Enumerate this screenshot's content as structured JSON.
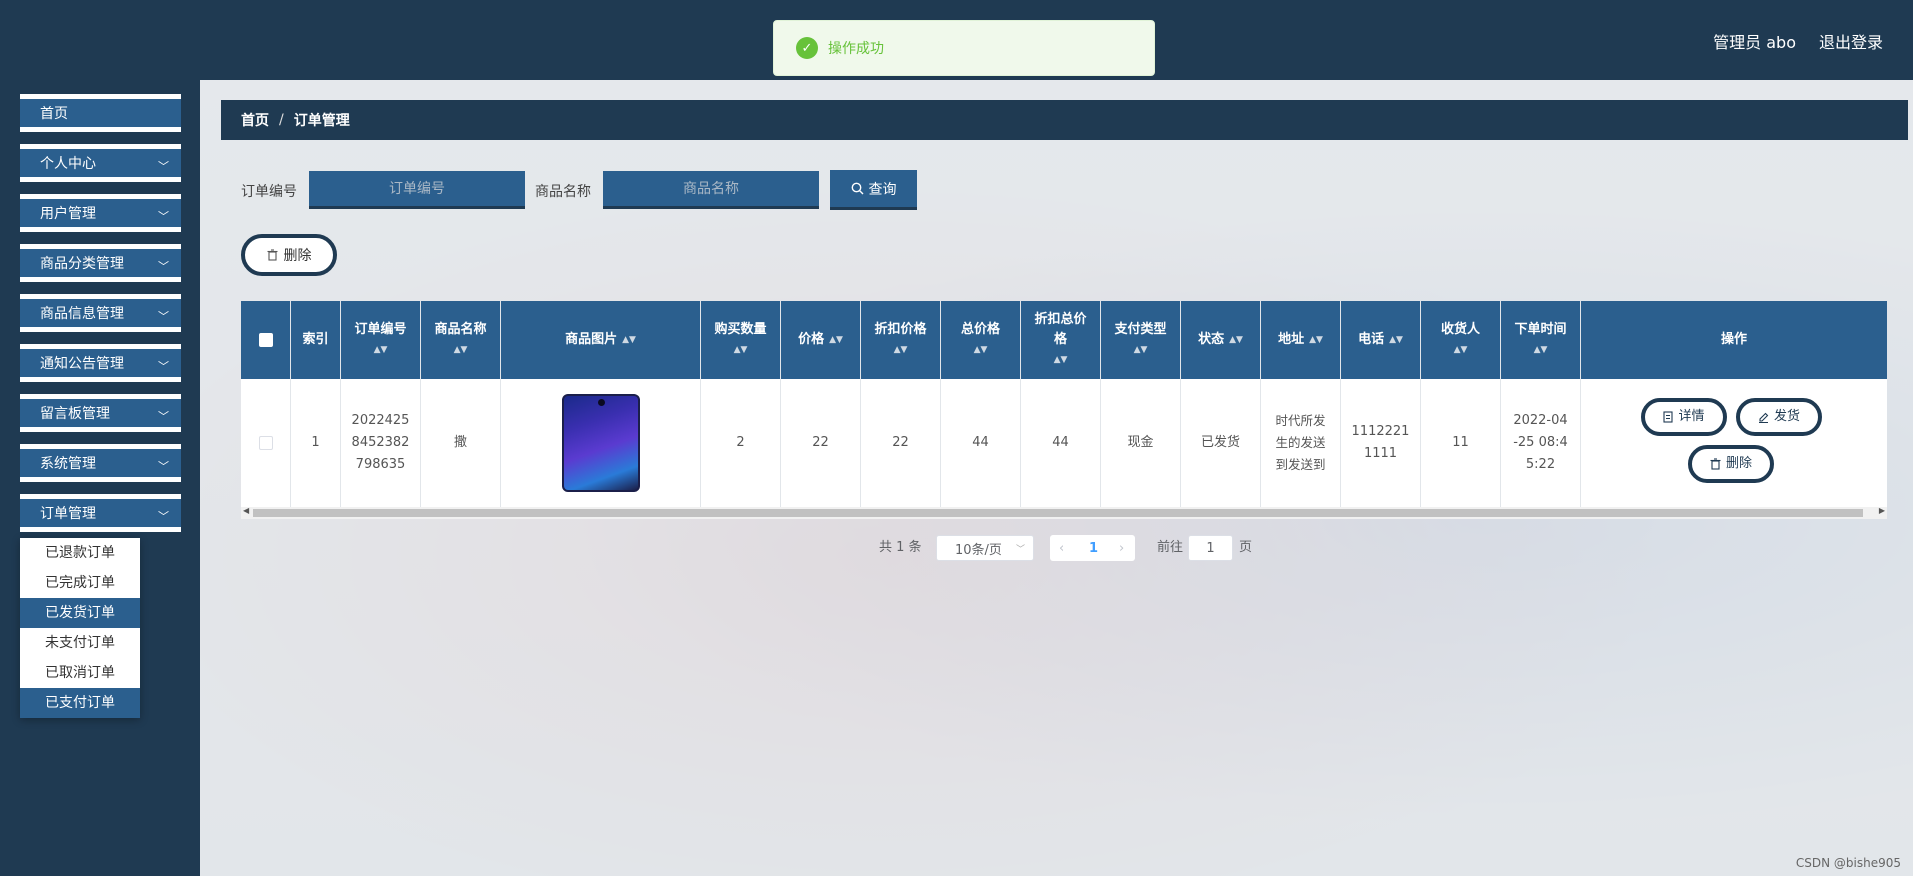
{
  "header": {
    "user_label": "管理员 abo",
    "logout_label": "退出登录"
  },
  "toast": {
    "message": "操作成功"
  },
  "sidebar": {
    "items": [
      {
        "label": "首页"
      },
      {
        "label": "个人中心"
      },
      {
        "label": "用户管理"
      },
      {
        "label": "商品分类管理"
      },
      {
        "label": "商品信息管理"
      },
      {
        "label": "通知公告管理"
      },
      {
        "label": "留言板管理"
      },
      {
        "label": "系统管理"
      },
      {
        "label": "订单管理"
      }
    ],
    "submenu": [
      {
        "label": "已退款订单"
      },
      {
        "label": "已完成订单"
      },
      {
        "label": "已发货订单"
      },
      {
        "label": "未支付订单"
      },
      {
        "label": "已取消订单"
      },
      {
        "label": "已支付订单"
      }
    ]
  },
  "breadcrumb": {
    "home": "首页",
    "separator": "/",
    "current": "订单管理"
  },
  "search": {
    "order_no_label": "订单编号",
    "order_no_placeholder": "订单编号",
    "product_label": "商品名称",
    "product_placeholder": "商品名称",
    "query_label": "查询"
  },
  "toolbar": {
    "delete_label": "删除"
  },
  "table": {
    "headers": {
      "index": "索引",
      "order_no": "订单编号",
      "product_name": "商品名称",
      "product_image": "商品图片",
      "quantity": "购买数量",
      "price": "价格",
      "discount_price": "折扣价格",
      "total_price": "总价格",
      "discount_total": "折扣总价格",
      "pay_type": "支付类型",
      "status": "状态",
      "address": "地址",
      "phone": "电话",
      "receiver": "收货人",
      "order_time": "下单时间",
      "actions": "操作"
    },
    "rows": [
      {
        "index": "1",
        "order_no": "2022425\n8452382\n798635",
        "product_name": "撒",
        "quantity": "2",
        "price": "22",
        "discount_price": "22",
        "total_price": "44",
        "discount_total": "44",
        "pay_type": "现金",
        "status": "已发货",
        "address": "时代所发\n生的发送\n到发送到",
        "phone": "1112221\n1111",
        "receiver": "11",
        "order_time": "2022-04\n-25 08:4\n5:22",
        "actions": {
          "detail": "详情",
          "ship": "发货",
          "delete": "删除"
        }
      }
    ]
  },
  "pagination": {
    "total_text": "共 1 条",
    "page_size": "10条/页",
    "current_page": "1",
    "goto_label": "前往",
    "goto_value": "1",
    "page_suffix": "页"
  },
  "watermark": "CSDN @bishe905"
}
